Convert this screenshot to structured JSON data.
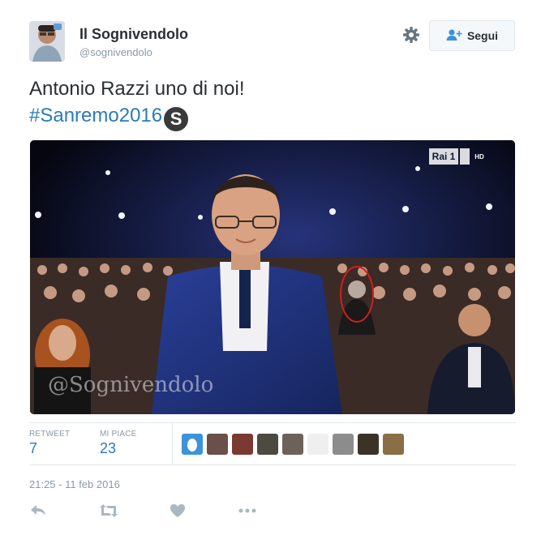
{
  "author": {
    "name": "Il Sognivendolo",
    "handle": "@sognivendolo"
  },
  "follow_button": {
    "label": "Segui"
  },
  "tweet": {
    "text": "Antonio Razzi uno di noi!",
    "hashtag": "#Sanremo2016",
    "hashtag_badge": "S"
  },
  "media": {
    "channel_logo": "Rai 1",
    "channel_hd": "HD",
    "watermark": "@Sognivendolo"
  },
  "stats": {
    "retweets_label": "RETWEET",
    "retweets_value": "7",
    "likes_label": "MI PIACE",
    "likes_value": "23"
  },
  "likers": [
    {
      "icon": "avatar-egg-icon",
      "color": "#3b94d9"
    },
    {
      "icon": "avatar-icon",
      "color": "#6b4f4a"
    },
    {
      "icon": "avatar-icon",
      "color": "#7a3a32"
    },
    {
      "icon": "avatar-icon",
      "color": "#4d4a3f"
    },
    {
      "icon": "avatar-icon",
      "color": "#6d625a"
    },
    {
      "icon": "avatar-icon",
      "color": "#efefef"
    },
    {
      "icon": "avatar-icon",
      "color": "#8c8c8c"
    },
    {
      "icon": "avatar-icon",
      "color": "#3c3327"
    },
    {
      "icon": "avatar-icon",
      "color": "#8a6e45"
    }
  ],
  "timestamp": "21:25 - 11 feb 2016",
  "actions": [
    "reply-icon",
    "retweet-icon",
    "like-icon",
    "more-icon"
  ],
  "colors": {
    "link": "#2b7bb9",
    "muted": "#8899a6",
    "text": "#292f33",
    "border": "#e1e8ed",
    "icon": "#aab8c2"
  }
}
